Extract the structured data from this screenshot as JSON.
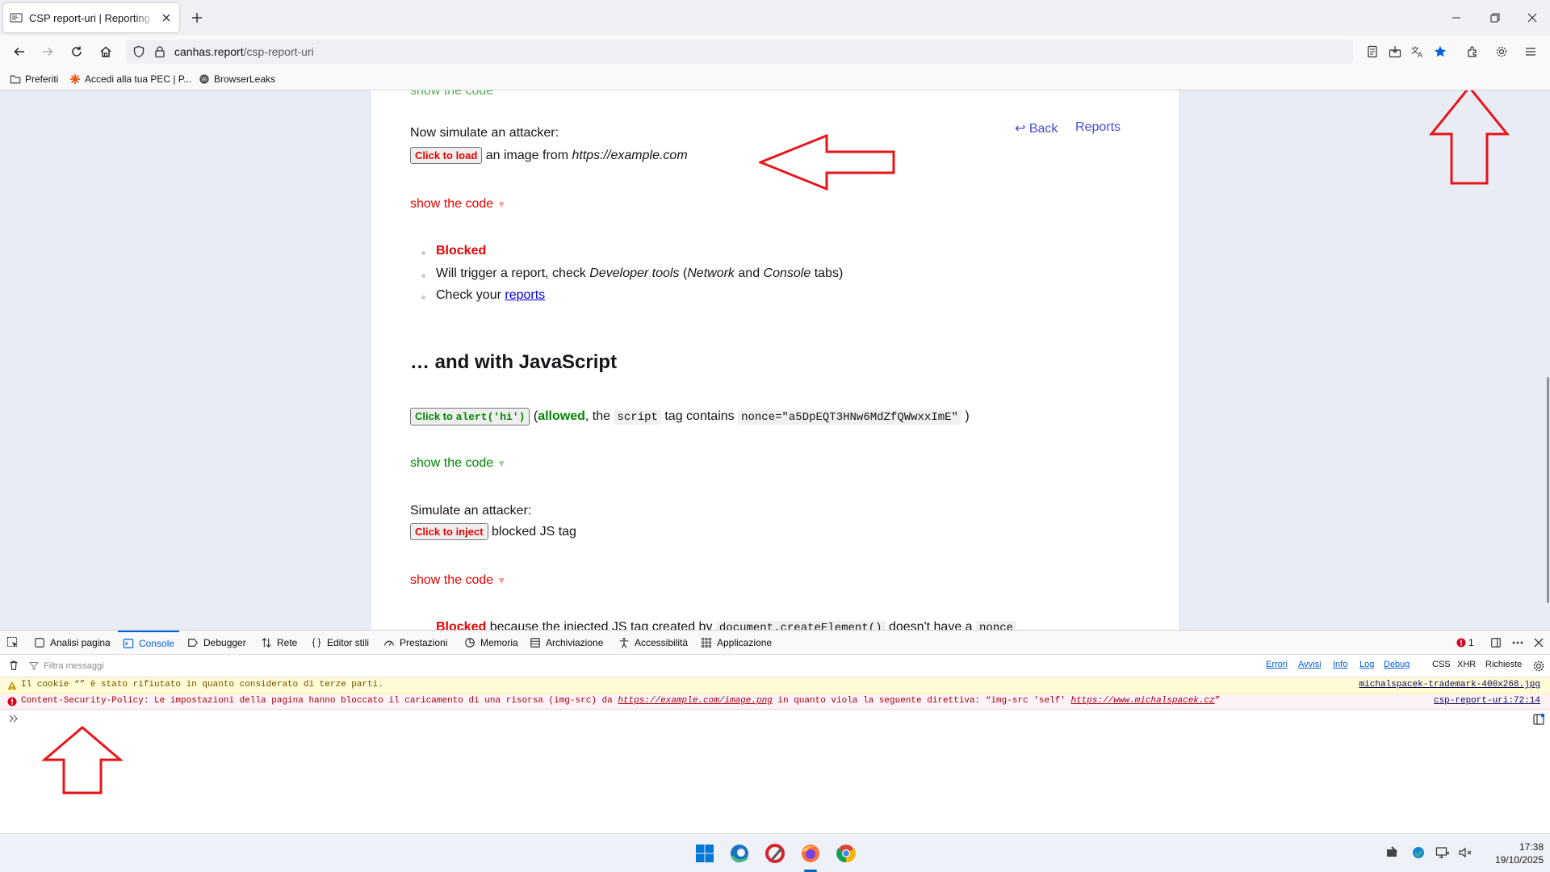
{
  "browser": {
    "tab_title": "CSP report-uri | Reporting API D",
    "url_host": "canhas.report",
    "url_path": "/csp-report-uri",
    "bookmarks": [
      "Preferiti",
      "Accedi alla tua PEC | P...",
      "BrowserLeaks"
    ]
  },
  "page": {
    "cut_top": "show the code",
    "attacker_intro": "Now simulate an attacker:",
    "load_button": "Click to load",
    "image_from": "an image from",
    "example_url": "https://example.com",
    "back_link": "↩ Back",
    "reports_link": "Reports",
    "show_code": "show the code",
    "blocked": "Blocked",
    "trigger_pre": "Will trigger a report, check",
    "devtools_label": "Developer tools",
    "network": "Network",
    "and": "and",
    "console": "Console",
    "tabs_suffix": "tabs)",
    "check_your": "Check your",
    "reports_anchor": "reports",
    "js_heading": "… and with JavaScript",
    "alert_btn_prefix": "Click to",
    "alert_btn_code": "alert('hi')",
    "allowed": "allowed",
    "the": ", the",
    "script_code": "script",
    "tag_contains": "tag contains",
    "nonce_code": "nonce=\"a5DpEQT3HNw6MdZfQWwxxImE\"",
    "simulate": "Simulate an attacker:",
    "inject_button": "Click to inject",
    "blocked_js": "blocked JS tag",
    "bottom_cut": "because the injected JS tag created by",
    "bottom_code": "document.createElement()",
    "bottom_tail": "doesn't have a",
    "bottom_code2": "nonce"
  },
  "devtools": {
    "tabs": [
      "Analisi pagina",
      "Console",
      "Debugger",
      "Rete",
      "Editor stili",
      "Prestazioni",
      "Memoria",
      "Archiviazione",
      "Accessibilità",
      "Applicazione"
    ],
    "error_count": "1",
    "filter_placeholder": "Filtra messaggi",
    "filters": [
      "Errori",
      "Avvisi",
      "Info",
      "Log",
      "Debug"
    ],
    "extra_filters": [
      "CSS",
      "XHR",
      "Richieste"
    ],
    "warning": "Il cookie “” è stato rifiutato in quanto considerato di terze parti.",
    "warning_source": "michalspacek-trademark-400x268.jpg",
    "error_pre": "Content-Security-Policy: Le impostazioni della pagina hanno bloccato il caricamento di una risorsa (img-src) da",
    "error_link1": "https://example.com/image.png",
    "error_mid": "in quanto viola la seguente direttiva: “img-src 'self'",
    "error_link2": "https://www.michalspacek.cz",
    "error_end": "”",
    "error_source": "csp-report-uri:72:14"
  },
  "taskbar": {
    "time": "17:38",
    "date": "19/10/2025"
  },
  "colors": {
    "annotation_arrow": "#e8141b",
    "accent": "#0060df"
  }
}
